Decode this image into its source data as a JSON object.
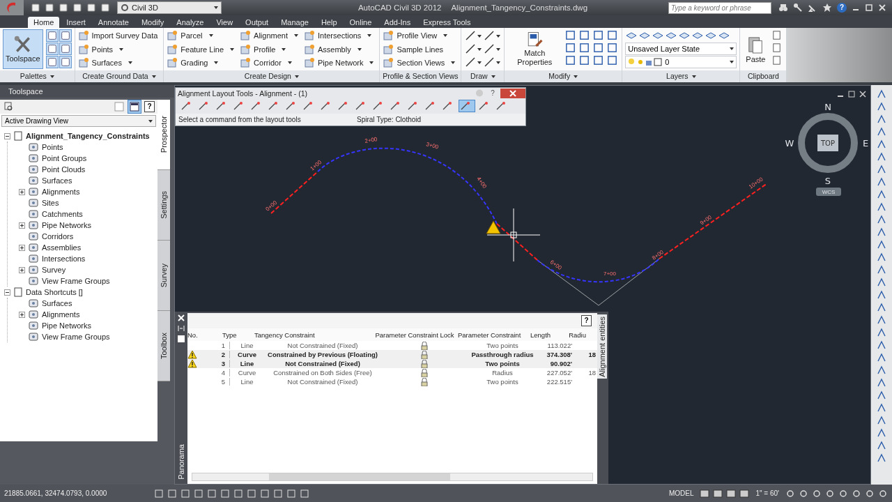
{
  "app": {
    "title": "AutoCAD Civil 3D 2012",
    "document": "Alignment_Tangency_Constraints.dwg",
    "workspace": "Civil 3D",
    "search": {
      "placeholder": "Type a keyword or phrase"
    },
    "help": "?"
  },
  "ribbon_tabs": [
    {
      "label": "Home",
      "selected": true
    },
    {
      "label": "Insert",
      "selected": false
    },
    {
      "label": "Annotate",
      "selected": false
    },
    {
      "label": "Modify",
      "selected": false
    },
    {
      "label": "Analyze",
      "selected": false
    },
    {
      "label": "View",
      "selected": false
    },
    {
      "label": "Output",
      "selected": false
    },
    {
      "label": "Manage",
      "selected": false
    },
    {
      "label": "Help",
      "selected": false
    },
    {
      "label": "Online",
      "selected": false
    },
    {
      "label": "Add-Ins",
      "selected": false
    },
    {
      "label": "Express Tools",
      "selected": false
    }
  ],
  "ribbon_panels": [
    {
      "title": "Palettes",
      "menu": true,
      "kind": "palettes",
      "large": {
        "label": "Toolspace",
        "selected": true
      }
    },
    {
      "title": "Create Ground Data",
      "menu": true,
      "kind": "commands",
      "columns": [
        [
          {
            "label": "Import Survey Data",
            "dropdown": false
          },
          {
            "label": "Points",
            "dropdown": true
          },
          {
            "label": "Surfaces",
            "dropdown": true
          }
        ]
      ]
    },
    {
      "title": "Create Design",
      "menu": true,
      "kind": "commands",
      "columns": [
        [
          {
            "label": "Parcel",
            "dropdown": true
          },
          {
            "label": "Feature Line",
            "dropdown": true
          },
          {
            "label": "Grading",
            "dropdown": true
          }
        ],
        [
          {
            "label": "Alignment",
            "dropdown": true
          },
          {
            "label": "Profile",
            "dropdown": true
          },
          {
            "label": "Corridor",
            "dropdown": true
          }
        ],
        [
          {
            "label": "Intersections",
            "dropdown": true
          },
          {
            "label": "Assembly",
            "dropdown": true
          },
          {
            "label": "Pipe Network",
            "dropdown": true
          }
        ]
      ]
    },
    {
      "title": "Profile & Section Views",
      "menu": false,
      "kind": "commands",
      "columns": [
        [
          {
            "label": "Profile View",
            "dropdown": true
          },
          {
            "label": "Sample Lines",
            "dropdown": false
          },
          {
            "label": "Section Views",
            "dropdown": true
          }
        ]
      ]
    },
    {
      "title": "Draw",
      "menu": true,
      "kind": "tools"
    },
    {
      "title": "Modify",
      "menu": true,
      "kind": "modify",
      "large": {
        "label": "Match Properties",
        "selected": false
      }
    },
    {
      "title": "Layers",
      "menu": true,
      "kind": "layers",
      "layer_state": "Unsaved Layer State",
      "layer": "0"
    },
    {
      "title": "Clipboard",
      "menu": false,
      "kind": "clipboard",
      "large": {
        "label": "Paste",
        "selected": false
      }
    }
  ],
  "toolspace": {
    "title": "Toolspace",
    "help": "?",
    "view": "Active Drawing View",
    "tree": [
      {
        "label": "Alignment_Tangency_Constraints",
        "expanded": true,
        "children": [
          {
            "label": "Points"
          },
          {
            "label": "Point Groups"
          },
          {
            "label": "Point Clouds"
          },
          {
            "label": "Surfaces"
          },
          {
            "label": "Alignments",
            "expanded": false
          },
          {
            "label": "Sites"
          },
          {
            "label": "Catchments"
          },
          {
            "label": "Pipe Networks",
            "expanded": false
          },
          {
            "label": "Corridors"
          },
          {
            "label": "Assemblies",
            "expanded": false
          },
          {
            "label": "Intersections"
          },
          {
            "label": "Survey",
            "expanded": false
          },
          {
            "label": "View Frame Groups"
          }
        ]
      },
      {
        "label": "Data Shortcuts []",
        "expanded": true,
        "children": [
          {
            "label": "Surfaces"
          },
          {
            "label": "Alignments",
            "expanded": false
          },
          {
            "label": "Pipe Networks"
          },
          {
            "label": "View Frame Groups"
          }
        ]
      }
    ],
    "tabs": [
      {
        "label": "Prospector",
        "selected": true
      },
      {
        "label": "Settings",
        "selected": false
      },
      {
        "label": "Survey",
        "selected": false
      },
      {
        "label": "Toolbox",
        "selected": false
      }
    ]
  },
  "layout_tools": {
    "title": "Alignment Layout Tools - Alignment - (1)",
    "help": "?",
    "prompt": "Select a command from the layout tools",
    "spiral": "Spiral Type: Clothoid"
  },
  "drawing": {
    "stations": [
      "0+00",
      "1+00",
      "2+00",
      "3+00",
      "4+00",
      "6+00",
      "7+00",
      "8+00",
      "9+00",
      "10+00"
    ],
    "compass": {
      "north": "N",
      "south": "S",
      "east": "E",
      "west": "W",
      "view": "TOP",
      "ucs": "WCS"
    }
  },
  "panorama": {
    "title": "Panorama",
    "tab": "Alignment entities",
    "help": "?",
    "columns": [
      "No.",
      "Type",
      "Tangency Constraint",
      "Parameter Constraint Lock",
      "Parameter Constraint",
      "Length",
      "Radiu"
    ],
    "rows": [
      {
        "no": "1",
        "type": "Line",
        "tangency": "Not Constrained (Fixed)",
        "param": "Two points",
        "length": "113.022'",
        "warning": false,
        "selected": false
      },
      {
        "no": "2",
        "type": "Curve",
        "tangency": "Constrained by Previous (Floating)",
        "param": "Passthrough radius",
        "length": "374.308'",
        "radius": "18",
        "warning": true,
        "selected": true
      },
      {
        "no": "3",
        "type": "Line",
        "tangency": "Not Constrained (Fixed)",
        "param": "Two points",
        "length": "90.902'",
        "warning": true,
        "selected": true
      },
      {
        "no": "4",
        "type": "Curve",
        "tangency": "Constrained on Both Sides (Free)",
        "param": "Radius",
        "length": "227.052'",
        "radius": "18",
        "warning": false,
        "selected": false
      },
      {
        "no": "5",
        "type": "Line",
        "tangency": "Not Constrained (Fixed)",
        "param": "Two points",
        "length": "222.515'",
        "warning": false,
        "selected": false
      }
    ]
  },
  "status_bar": {
    "coordinates": "21885.0661, 32474.0793, 0.0000",
    "space": "MODEL",
    "scale": "1\" = 60'"
  }
}
